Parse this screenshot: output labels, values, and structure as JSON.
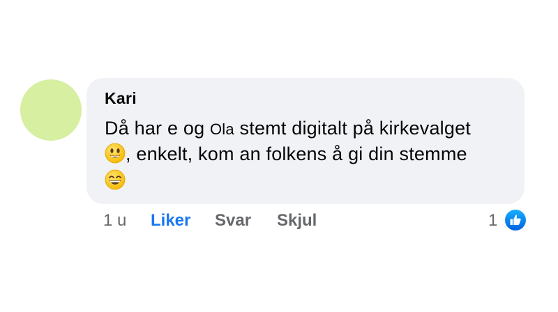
{
  "comment": {
    "author": "Kari",
    "text_line1_a": "Då har e og ",
    "text_line1_name": "Ola",
    "text_line1_b": " stemt digitalt på kirkevalget",
    "text_line2": ", enkelt, kom an folkens å gi din stemme",
    "emoji_1": "smiling-face-icon",
    "emoji_2": "grinning-face-icon"
  },
  "actions": {
    "time": "1 u",
    "like": "Liker",
    "reply": "Svar",
    "hide": "Skjul"
  },
  "reactions": {
    "count": "1",
    "type": "like-icon"
  },
  "colors": {
    "avatar": "#d6efa0",
    "bubble": "#f0f2f5",
    "like_accent": "#1877f2",
    "secondary_text": "#65676b"
  }
}
